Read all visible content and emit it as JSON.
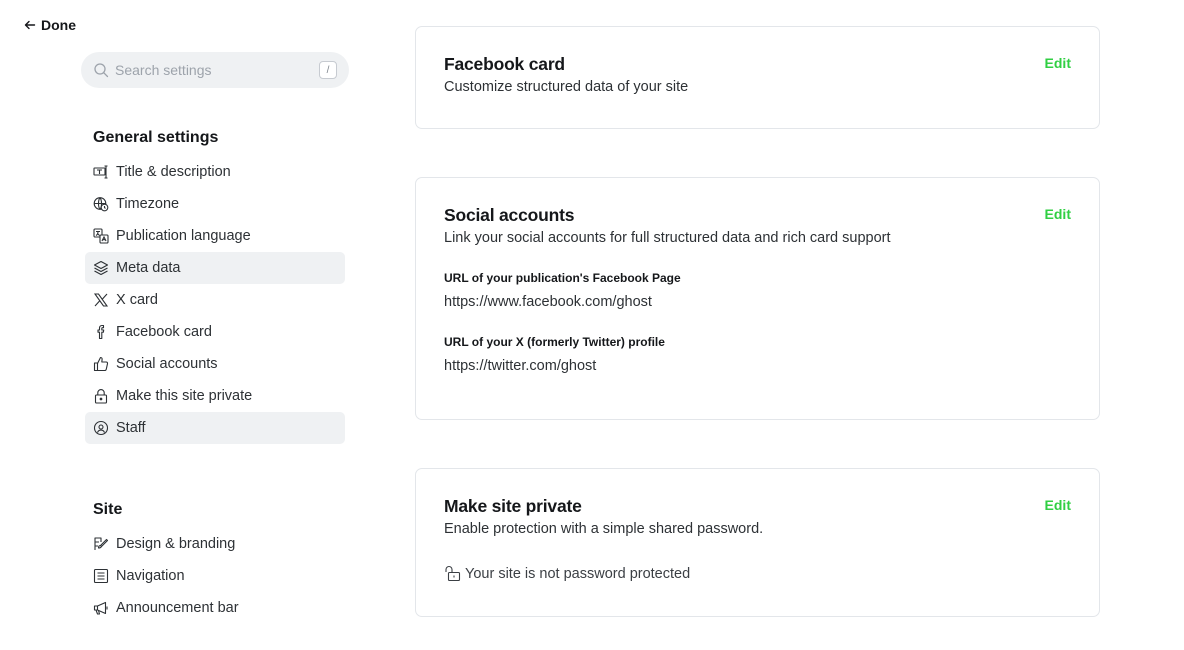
{
  "header": {
    "done_label": "Done"
  },
  "search": {
    "placeholder": "Search settings",
    "shortcut": "/"
  },
  "sidebar": {
    "general": {
      "title": "General settings",
      "items": [
        {
          "label": "Title & description",
          "icon": "title-icon"
        },
        {
          "label": "Timezone",
          "icon": "globe-clock-icon"
        },
        {
          "label": "Publication language",
          "icon": "translate-icon"
        },
        {
          "label": "Meta data",
          "icon": "layers-icon"
        },
        {
          "label": "X card",
          "icon": "x-logo-icon"
        },
        {
          "label": "Facebook card",
          "icon": "facebook-icon"
        },
        {
          "label": "Social accounts",
          "icon": "thumbs-up-icon"
        },
        {
          "label": "Make this site private",
          "icon": "lock-icon"
        },
        {
          "label": "Staff",
          "icon": "staff-icon"
        }
      ]
    },
    "site": {
      "title": "Site",
      "items": [
        {
          "label": "Design & branding",
          "icon": "brush-icon"
        },
        {
          "label": "Navigation",
          "icon": "list-icon"
        },
        {
          "label": "Announcement bar",
          "icon": "megaphone-icon"
        }
      ]
    }
  },
  "cards": {
    "facebook": {
      "title": "Facebook card",
      "description": "Customize structured data of your site",
      "edit_label": "Edit"
    },
    "social": {
      "title": "Social accounts",
      "description": "Link your social accounts for full structured data and rich card support",
      "edit_label": "Edit",
      "facebook_label": "URL of your publication's Facebook Page",
      "facebook_value": "https://www.facebook.com/ghost",
      "twitter_label": "URL of your X (formerly Twitter) profile",
      "twitter_value": "https://twitter.com/ghost"
    },
    "private": {
      "title": "Make site private",
      "description": "Enable protection with a simple shared password.",
      "edit_label": "Edit",
      "status": "Your site is not password protected"
    }
  },
  "colors": {
    "accent": "#30cf43",
    "active_bg": "#eff1f3",
    "border": "#e3e6ea"
  }
}
